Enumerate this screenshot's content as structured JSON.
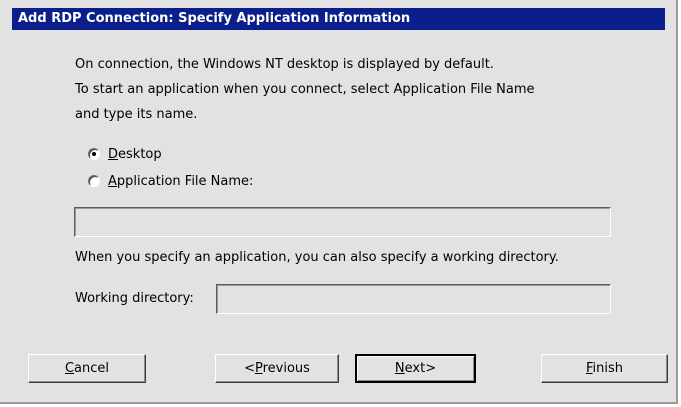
{
  "window": {
    "title": "Add RDP Connection: Specify Application Information"
  },
  "intro": {
    "line1": "On connection, the Windows NT desktop is displayed by default.",
    "line2": "To start an application when you connect, select Application File Name",
    "line3": "and type its name."
  },
  "options": {
    "desktop": {
      "mnemonic": "D",
      "rest": "esktop",
      "selected": true
    },
    "app_file": {
      "mnemonic": "A",
      "rest": "pplication File Name:",
      "selected": false
    }
  },
  "app_file_input": {
    "value": ""
  },
  "working_dir": {
    "note": "When you specify an application, you can also specify a working directory.",
    "label": "Working directory:",
    "value": ""
  },
  "buttons": {
    "cancel": {
      "mnemonic": "C",
      "rest": "ancel"
    },
    "previous": {
      "prefix": "<",
      "mnemonic": "P",
      "rest": "revious"
    },
    "next": {
      "mnemonic": "N",
      "rest": "ext>"
    },
    "finish": {
      "mnemonic": "F",
      "rest": "inish"
    }
  },
  "colors": {
    "titlebar": "#0b1f8c",
    "background": "#e2e2e2"
  }
}
